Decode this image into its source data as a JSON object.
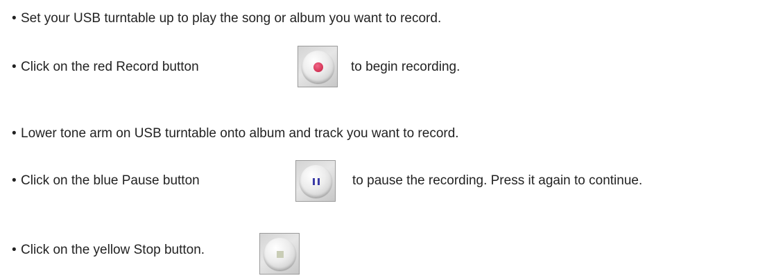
{
  "instructions": {
    "bullet": "•",
    "steps": [
      {
        "text": "Set your USB turntable up to play the song or album you want to record."
      },
      {
        "text": "Click on the red Record button",
        "after": "to begin recording.",
        "icon": "record-button-icon",
        "icon_color": "#d83a5c"
      },
      {
        "text": "Lower tone arm on USB turntable onto album and track you want to record."
      },
      {
        "text": "Click on the blue Pause button",
        "after": "to pause the recording. Press it again to continue.",
        "icon": "pause-button-icon",
        "icon_color": "#3a3aa6"
      },
      {
        "text": "Click on the yellow Stop button.",
        "icon": "stop-button-icon",
        "icon_color": "#c9cdb6"
      }
    ]
  }
}
